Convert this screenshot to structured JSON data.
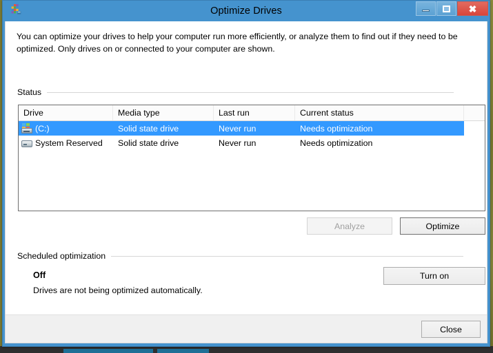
{
  "window": {
    "title": "Optimize Drives",
    "icon": "optimize-drives-icon",
    "controls": {
      "minimize_label": "Minimize",
      "maximize_label": "Maximize",
      "close_label": "Close"
    }
  },
  "intro": {
    "text": "You can optimize your drives to help your computer run more efficiently, or analyze them to find out if they need to be optimized. Only drives on or connected to your computer are shown."
  },
  "status_group": {
    "label": "Status"
  },
  "list": {
    "columns": [
      "Drive",
      "Media type",
      "Last run",
      "Current status",
      ""
    ],
    "rows": [
      {
        "icon": "system-drive-icon",
        "drive": "(C:)",
        "media_type": "Solid state drive",
        "last_run": "Never run",
        "current_status": "Needs optimization",
        "selected": true
      },
      {
        "icon": "drive-icon",
        "drive": "System Reserved",
        "media_type": "Solid state drive",
        "last_run": "Never run",
        "current_status": "Needs optimization",
        "selected": false
      }
    ]
  },
  "actions": {
    "analyze_label": "Analyze",
    "analyze_enabled": false,
    "optimize_label": "Optimize",
    "optimize_enabled": true
  },
  "scheduled": {
    "group_label": "Scheduled optimization",
    "state": "Off",
    "description": "Drives are not being optimized automatically.",
    "turn_on_label": "Turn on"
  },
  "footer": {
    "close_label": "Close"
  },
  "colors": {
    "titlebar": "#4593ce",
    "selection": "#3399ff",
    "close_button": "#d8453a",
    "footer_bg": "#f0f0f0"
  }
}
